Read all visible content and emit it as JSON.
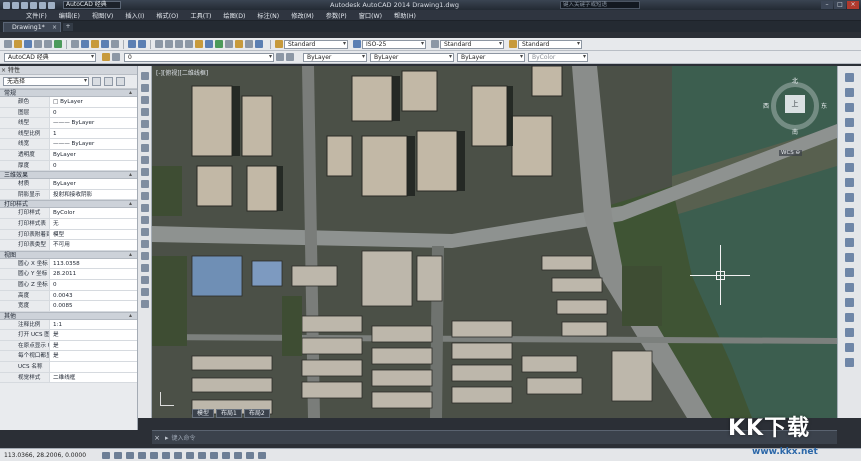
{
  "titlebar": {
    "workspace": "AutoCAD 经典",
    "title": "Autodesk AutoCAD 2014    Drawing1.dwg",
    "search_placeholder": "键入关键字或短语",
    "min": "–",
    "max": "□",
    "close": "×"
  },
  "menu": [
    "文件(F)",
    "编辑(E)",
    "视图(V)",
    "插入(I)",
    "格式(O)",
    "工具(T)",
    "绘图(D)",
    "标注(N)",
    "修改(M)",
    "参数(P)",
    "窗口(W)",
    "帮助(H)"
  ],
  "doc_tab": {
    "label": "Drawing1*",
    "close": "×",
    "new": "+"
  },
  "toolbar1": {
    "text_style": "Standard",
    "dim_style": "ISO-25",
    "table_style": "Standard",
    "mleader_style": "Standard"
  },
  "toolbar2": {
    "workspace": "AutoCAD 经典",
    "layer": "0",
    "color": "ByLayer",
    "linetype": "ByLayer",
    "lineweight": "ByLayer",
    "plotstyle": "ByColor"
  },
  "palette": {
    "title": "特性",
    "close": "×",
    "selection": "无选择",
    "sections": [
      {
        "name": "常规",
        "rows": [
          {
            "k": "颜色",
            "v": "□ ByLayer"
          },
          {
            "k": "图层",
            "v": "0"
          },
          {
            "k": "线型",
            "v": "——— ByLayer"
          },
          {
            "k": "线型比例",
            "v": "1"
          },
          {
            "k": "线宽",
            "v": "——— ByLayer"
          },
          {
            "k": "透明度",
            "v": "ByLayer"
          },
          {
            "k": "厚度",
            "v": "0"
          }
        ]
      },
      {
        "name": "三维效果",
        "rows": [
          {
            "k": "材质",
            "v": "ByLayer"
          },
          {
            "k": "阴影显示",
            "v": "投射和接收阴影"
          }
        ]
      },
      {
        "name": "打印样式",
        "rows": [
          {
            "k": "打印样式",
            "v": "ByColor"
          },
          {
            "k": "打印样式表",
            "v": "无"
          },
          {
            "k": "打印表附着到",
            "v": "模型"
          },
          {
            "k": "打印表类型",
            "v": "不可用"
          }
        ]
      },
      {
        "name": "视图",
        "rows": [
          {
            "k": "圆心 X 坐标",
            "v": "113.0358"
          },
          {
            "k": "圆心 Y 坐标",
            "v": "28.2011"
          },
          {
            "k": "圆心 Z 坐标",
            "v": "0"
          },
          {
            "k": "高度",
            "v": "0.0043"
          },
          {
            "k": "宽度",
            "v": "0.0085"
          }
        ]
      },
      {
        "name": "其他",
        "rows": [
          {
            "k": "注释比例",
            "v": "1:1"
          },
          {
            "k": "打开 UCS 图标",
            "v": "是"
          },
          {
            "k": "在原点显示 U...",
            "v": "是"
          },
          {
            "k": "每个视口都显...",
            "v": "是"
          },
          {
            "k": "UCS 名称",
            "v": ""
          },
          {
            "k": "视觉样式",
            "v": "二维线框"
          }
        ]
      }
    ]
  },
  "viewport": {
    "label": "[-][俯视][二维线框]",
    "tabs": [
      "模型",
      "布局1",
      "布局2"
    ]
  },
  "viewcube": {
    "top": "上",
    "n": "北",
    "s": "南",
    "w": "西",
    "e": "东",
    "wcs": "WCS ⊖"
  },
  "command": {
    "prompt": "▸",
    "placeholder": "键入命令"
  },
  "status": {
    "coords": "113.0366, 28.2006, 0.0000"
  },
  "watermark": {
    "brand": "KK下载",
    "url": "www.kkx.net"
  }
}
